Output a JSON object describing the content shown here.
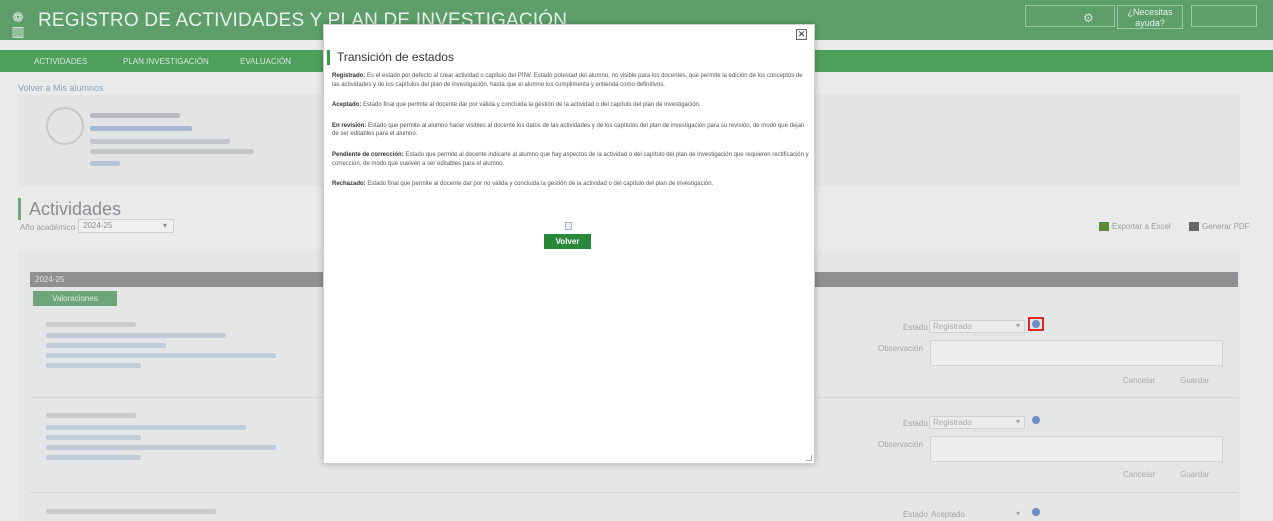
{
  "header": {
    "title": "REGISTRO DE ACTIVIDADES Y PLAN DE INVESTIGACIÓN",
    "help_label": "¿Necesitas ayuda?"
  },
  "nav": {
    "items": [
      "ACTIVIDADES",
      "PLAN INVESTIGACIÓN",
      "EVALUACIÓN"
    ]
  },
  "back_link": "Volver a Mis alumnos",
  "activities": {
    "title": "Actividades",
    "year_label": "Año académico",
    "year_value": "2024-25",
    "export_excel": "Exportar a Excel",
    "generate_pdf": "Generar PDF",
    "year_bar": "2024-25",
    "valoraciones_button": "Valoraciones",
    "items": [
      {
        "estado_label": "Estado",
        "estado_value": "Registrado",
        "obs_label": "Observación",
        "cancel": "Cancelar",
        "save": "Guardar"
      },
      {
        "estado_label": "Estado",
        "estado_value": "Registrado",
        "obs_label": "Observación",
        "cancel": "Cancelar",
        "save": "Guardar"
      },
      {
        "estado_label": "Estado",
        "estado_value": "Aceptado"
      }
    ]
  },
  "modal": {
    "title": "Transición de estados",
    "entries": [
      {
        "term": "Registrado:",
        "text": "Es el estado por defecto al crear actividad o capítulo del PIIW. Estado potestad del alumno, no visible para los docentes, que permite la edición de los conceptos de las actividades y de los capítulos del plan de investigación, hasta que el alumno los cumplimenta y entienda como definitivos."
      },
      {
        "term": "Aceptado:",
        "text": "Estado final que permite al docente dar por válida y concluida la gestión de la actividad o del capítulo del plan de investigación."
      },
      {
        "term": "En revisión:",
        "text": "Estado que permite al alumno hacer visibles al docente los datos de las actividades y de los capítulos del plan de investigación para su revisión, de modo que dejan de ser editables para el alumno."
      },
      {
        "term": "Pendiente de corrección:",
        "text": "Estado que permite al docente indicarle al alumno que hay aspectos de la actividad o del capítulo del plan de investigación que requieren rectificación y corrección, de modo que vuelven a ser editables para el alumno."
      },
      {
        "term": "Rechazado:",
        "text": "Estado final que permite al docente dar por no válida y concluida la gestión de la actividad o del capítulo del plan de investigación."
      }
    ],
    "volver_label": "Volver",
    "close_glyph": "✕"
  },
  "colors": {
    "header_green": "#5e9e6a",
    "nav_green": "#4e9f5c",
    "button_green": "#27883a",
    "highlight_red": "#d92a2a"
  }
}
